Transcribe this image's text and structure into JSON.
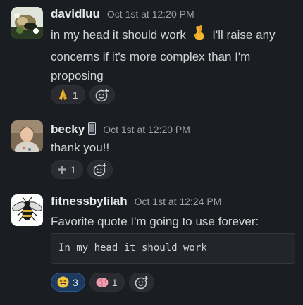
{
  "messages": [
    {
      "author": "davidluu",
      "timestamp": "Oct 1st at 12:20 PM",
      "text_before_emoji": "in my head it should work",
      "inline_emoji": "crossed-fingers",
      "text_after_emoji": "I'll raise any concerns if it's more complex than I'm proposing",
      "reactions": [
        {
          "emoji": "folded-hands",
          "count": "1",
          "active": false
        }
      ]
    },
    {
      "author": "becky",
      "status_emoji": "mobile-phone",
      "timestamp": "Oct 1st at 12:20 PM",
      "text": "thank you!!",
      "reactions": [
        {
          "emoji": "heavy-plus-sign",
          "count": "1",
          "active": false
        }
      ]
    },
    {
      "author": "fitnessbylilah",
      "timestamp": "Oct 1st at 12:24 PM",
      "text": "Favorite quote I'm going to use forever:",
      "code": "In my head it should work",
      "reactions": [
        {
          "emoji": "laughing",
          "count": "3",
          "active": true
        },
        {
          "emoji": "brain",
          "count": "1",
          "active": false
        }
      ]
    }
  ],
  "colors": {
    "background": "#1a1d21",
    "active_reaction": "#1d3b5e",
    "text": "#d1d2d3"
  }
}
